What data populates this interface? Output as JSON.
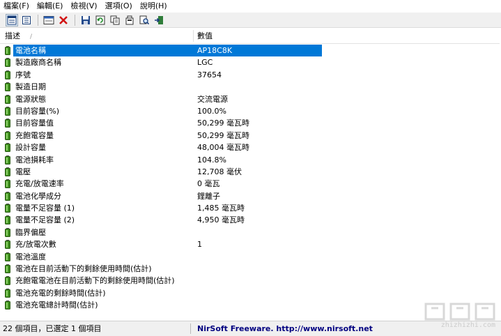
{
  "menu": [
    {
      "label": "檔案(F)"
    },
    {
      "label": "編輯(E)"
    },
    {
      "label": "檢視(V)"
    },
    {
      "label": "選項(O)"
    },
    {
      "label": "說明(H)"
    }
  ],
  "toolbar": {
    "buttons": [
      {
        "icon": "view-mode-1-icon"
      },
      {
        "icon": "view-mode-2-icon"
      },
      {
        "icon": "properties-icon"
      },
      {
        "icon": "delete-icon"
      },
      {
        "icon": "save-icon"
      },
      {
        "icon": "refresh-icon"
      },
      {
        "icon": "copy-icon"
      },
      {
        "icon": "html-report-icon"
      },
      {
        "icon": "find-icon"
      },
      {
        "icon": "exit-icon"
      }
    ]
  },
  "columns": {
    "description": "描述",
    "value": "數值",
    "sort_indicator": "/"
  },
  "rows": [
    {
      "desc": "電池名稱",
      "value": "AP18C8K"
    },
    {
      "desc": "製造廠商名稱",
      "value": "LGC"
    },
    {
      "desc": "序號",
      "value": "37654"
    },
    {
      "desc": "製造日期",
      "value": ""
    },
    {
      "desc": "電源狀態",
      "value": "交流電源"
    },
    {
      "desc": "目前容量(%)",
      "value": "100.0%"
    },
    {
      "desc": "目前容量值",
      "value": "50,299 毫瓦時"
    },
    {
      "desc": "充飽電容量",
      "value": "50,299 毫瓦時"
    },
    {
      "desc": "設計容量",
      "value": "48,004 毫瓦時"
    },
    {
      "desc": "電池損耗率",
      "value": "104.8%"
    },
    {
      "desc": "電壓",
      "value": "12,708 毫伏"
    },
    {
      "desc": "充電/放電速率",
      "value": "0 毫瓦"
    },
    {
      "desc": "電池化學成分",
      "value": "鋰離子"
    },
    {
      "desc": "電量不足容量 (1)",
      "value": "1,485 毫瓦時"
    },
    {
      "desc": "電量不足容量 (2)",
      "value": "4,950 毫瓦時"
    },
    {
      "desc": "臨界偏壓",
      "value": ""
    },
    {
      "desc": "充/放電次數",
      "value": "1"
    },
    {
      "desc": "電池溫度",
      "value": ""
    },
    {
      "desc": "電池在目前活動下的剩餘使用時間(估計)",
      "value": ""
    },
    {
      "desc": "充飽電電池在目前活動下的剩餘使用時間(估計)",
      "value": ""
    },
    {
      "desc": "電池充電的剩餘時間(估計)",
      "value": ""
    },
    {
      "desc": "電池充電總計時間(估計)",
      "value": ""
    }
  ],
  "selected_row": 0,
  "status": {
    "count": "22 個項目，已選定 1 個項目",
    "link": "NirSoft Freeware.  http://www.nirsoft.net"
  },
  "watermark": "zhizhizhi.com",
  "colors": {
    "selection": "#0078d7",
    "battery_green": "#3f8f1f",
    "link": "#000080"
  }
}
